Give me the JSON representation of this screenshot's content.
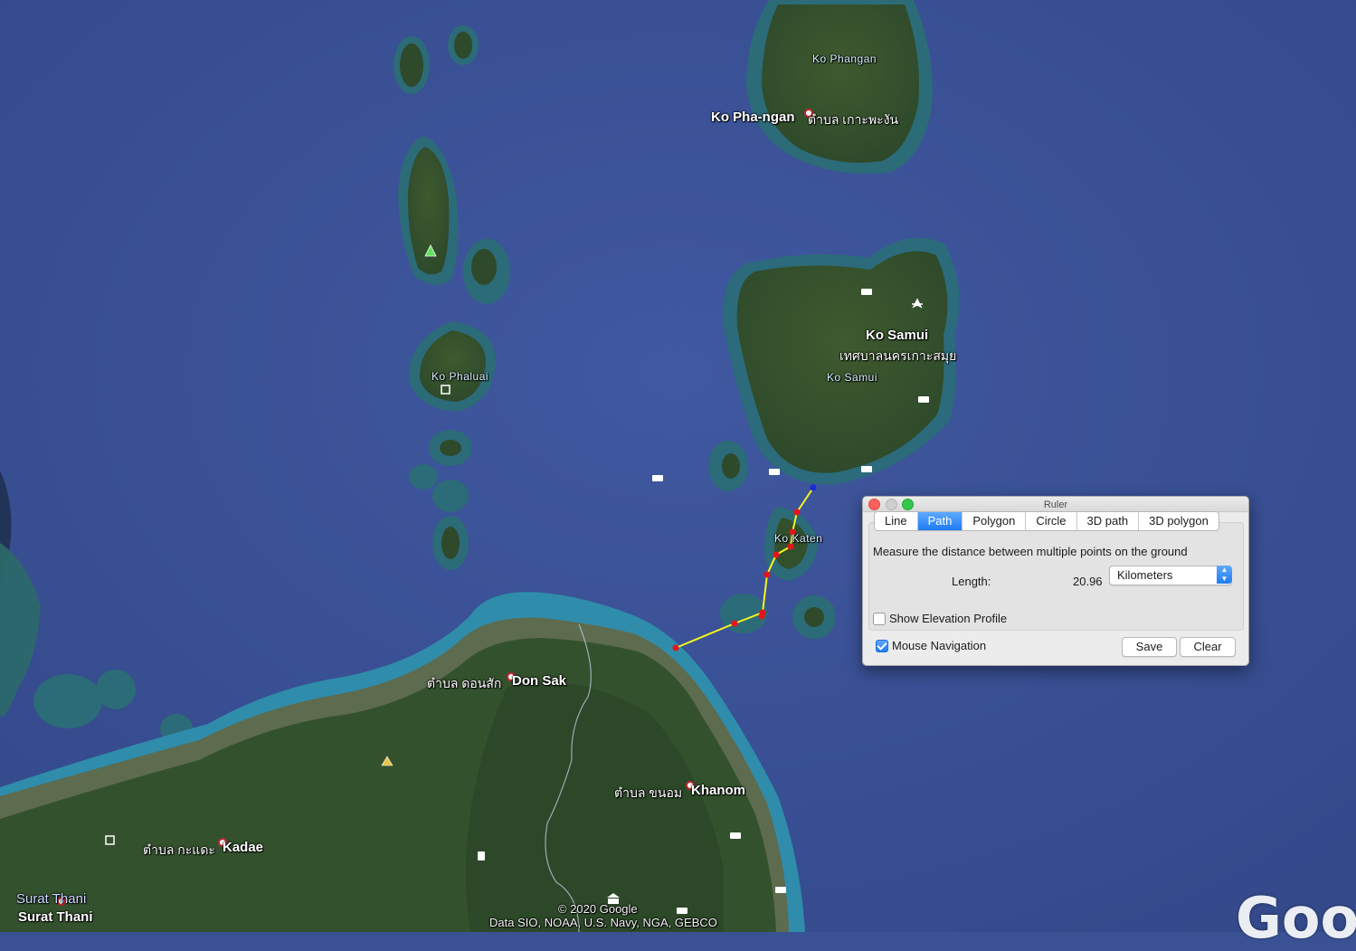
{
  "map": {
    "labels": {
      "ko_phangan_island": "Ko Phangan",
      "ko_pha_ngan_town": "Ko Pha-ngan",
      "ko_phangan_thai": "ตำบล เกาะพะงัน",
      "ko_samui_town": "Ko Samui",
      "ko_samui_thai": "เทศบาลนครเกาะสมุย",
      "ko_samui_island": "Ko Samui",
      "ko_phaluai": "Ko Phaluai",
      "ko_katen": "Ko Katen",
      "don_sak_thai": "ตำบล ดอนสัก",
      "don_sak": "Don Sak",
      "khanom_thai": "ตำบล ขนอม",
      "khanom": "Khanom",
      "kadae_thai": "ตำบล กะแดะ",
      "kadae": "Kadae",
      "surat_thani_1": "Surat Thani",
      "surat_thani_2": "Surat Thani"
    },
    "copyright": "© 2020 Google",
    "attribution": "Data SIO, NOAA, U.S. Navy, NGA, GEBCO",
    "logo": "Goog",
    "colors": {
      "ocean": "#3a5294",
      "path": "#f5f51e",
      "point": "#e8141a",
      "start_point": "#1a2cd6"
    }
  },
  "ruler": {
    "title": "Ruler",
    "tabs": [
      "Line",
      "Path",
      "Polygon",
      "Circle",
      "3D path",
      "3D polygon"
    ],
    "active_tab": "Path",
    "description": "Measure the distance between multiple points on the ground",
    "length_label": "Length:",
    "length_value": "20.96",
    "unit": "Kilometers",
    "show_elevation_label": "Show Elevation Profile",
    "show_elevation_checked": false,
    "mouse_navigation_label": "Mouse Navigation",
    "mouse_navigation_checked": true,
    "save_label": "Save",
    "clear_label": "Clear"
  }
}
